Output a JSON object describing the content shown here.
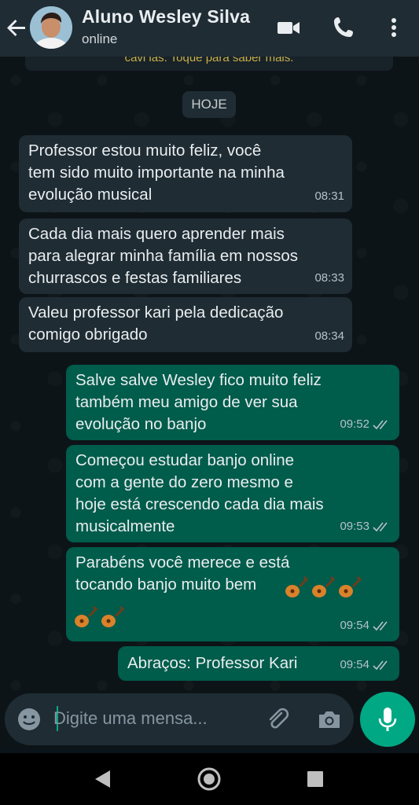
{
  "header": {
    "contact_name": "Aluno Wesley Silva",
    "status": "online",
    "icons": [
      "back-arrow-icon",
      "video-call-icon",
      "phone-icon",
      "more-options-icon"
    ]
  },
  "chat": {
    "system_note": "cavi ias. Toque para saber mais.",
    "date_label": "HOJE",
    "messages": [
      {
        "direction": "incoming",
        "text": "Professor estou muito feliz, você\ntem sido muito importante na minha\nevolução musical",
        "time": "08:31"
      },
      {
        "direction": "incoming",
        "text": "Cada dia mais quero aprender mais\npara alegrar minha família em nossos\nchurrascos e festas familiares",
        "time": "08:33"
      },
      {
        "direction": "incoming",
        "text": "Valeu professor kari pela dedicação\ncomigo obrigado",
        "time": "08:34"
      },
      {
        "direction": "outgoing",
        "text": "Salve salve Wesley fico muito feliz\ntambém meu amigo de ver sua\nevolução no banjo",
        "time": "09:52"
      },
      {
        "direction": "outgoing",
        "text": "Começou estudar banjo online\ncom a gente do zero mesmo e\nhoje está crescendo cada dia mais\nmusicalmente",
        "time": "09:53"
      },
      {
        "direction": "outgoing",
        "text": "Parabéns você merece e está\ntocando banjo muito bem",
        "time": "09:54",
        "emoji": "guitar-emoji",
        "emoji_count": 5
      },
      {
        "direction": "outgoing",
        "text": "Abraços: Professor Kari",
        "time": "09:54"
      }
    ]
  },
  "input": {
    "placeholder": "Digite uma mensa...",
    "icons": [
      "emoji-icon",
      "attach-icon",
      "camera-icon",
      "mic-icon"
    ]
  },
  "navbar": {
    "icons": [
      "nav-back-icon",
      "nav-home-icon",
      "nav-recents-icon"
    ]
  },
  "colors": {
    "header": "#1f2c34",
    "incoming_bubble": "#1f2c34",
    "outgoing_bubble": "#005c4b",
    "accent": "#00a884"
  }
}
